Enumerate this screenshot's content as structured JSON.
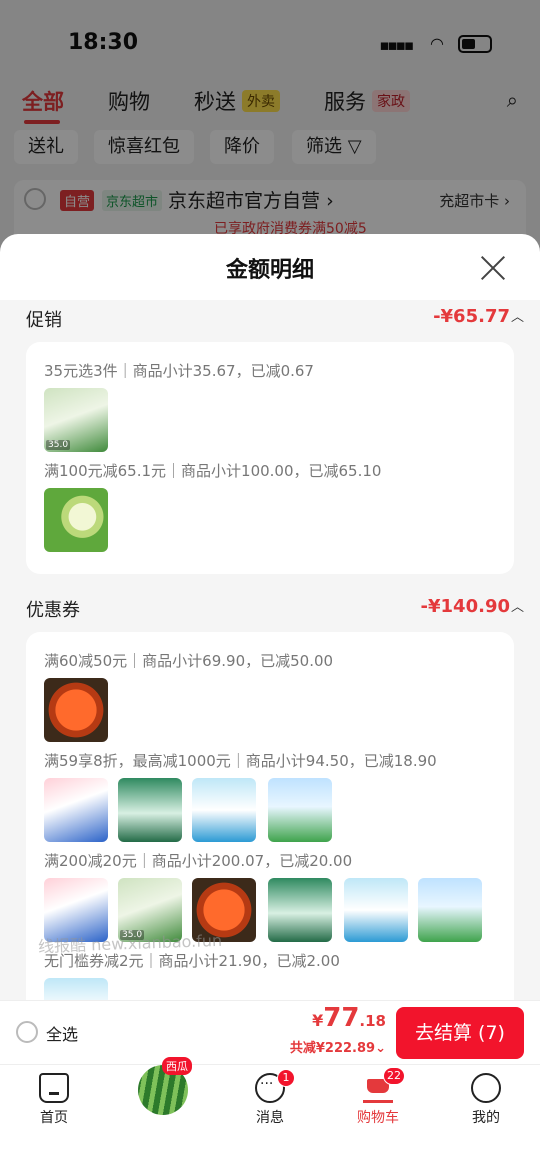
{
  "status_bar": {
    "time": "18:30"
  },
  "top_tabs": {
    "all": "全部",
    "shopping": "购物",
    "express": "秒送",
    "express_badge": "外卖",
    "service": "服务",
    "service_badge": "家政"
  },
  "filters": [
    "送礼",
    "惊喜红包",
    "降价",
    "筛选"
  ],
  "shop": {
    "tag_self": "自营",
    "tag_market": "京东超市",
    "name": "京东超市官方自营",
    "card_link": "充超市卡",
    "promo": "已享政府消费券满50减5"
  },
  "sheet": {
    "title": "金额明细",
    "promo_section": {
      "label": "促销",
      "amount": "-¥65.77",
      "rules": [
        "35元选3件｜商品小计35.67，已减0.67",
        "满100元减65.1元｜商品小计100.00，已减65.10"
      ]
    },
    "coupon_section": {
      "label": "优惠券",
      "amount": "-¥140.90",
      "rules": [
        "满60减50元｜商品小计69.90，已减50.00",
        "满59享8折，最高减1000元｜商品小计94.50，已减18.90",
        "满200减20元｜商品小计200.07，已减20.00",
        "无门槛券减2元｜商品小计21.90，已减2.00"
      ]
    }
  },
  "watermark": "线报酷 new.xianbao.fun",
  "checkout": {
    "select_all": "全选",
    "currency": "¥",
    "price_int": "77",
    "price_dec": ".18",
    "saved": "共减¥222.89",
    "button": "去结算 (7)"
  },
  "tabbar": {
    "home": "首页",
    "melon_tag": "西瓜",
    "messages": "消息",
    "messages_count": "1",
    "cart": "购物车",
    "cart_count": "22",
    "me": "我的"
  }
}
